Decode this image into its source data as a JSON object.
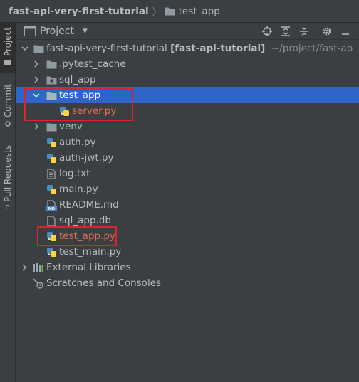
{
  "breadcrumb": {
    "root": "fast-api-very-first-tutorial",
    "current": "test_app"
  },
  "stripe": {
    "project": "Project",
    "commit": "Commit",
    "pull_requests": "Pull Requests"
  },
  "toolwindow": {
    "title": "Project",
    "dropdown_icon": "caret-down-icon",
    "actions": [
      "locate-icon",
      "expand-all-icon",
      "collapse-all-icon",
      "gear-icon",
      "minimize-icon"
    ]
  },
  "tree": {
    "root_name": "fast-api-very-first-tutorial",
    "root_module": "[fast-api-tutorial]",
    "root_path": "~/project/fast-ap",
    "items": [
      {
        "label": ".pytest_cache",
        "type": "folder",
        "expanded": false
      },
      {
        "label": "sql_app",
        "type": "package-folder",
        "expanded": false
      },
      {
        "label": "test_app",
        "type": "folder",
        "expanded": true,
        "selected": true
      },
      {
        "label": "server.py",
        "type": "python-file",
        "vcs": "untracked"
      },
      {
        "label": "venv",
        "type": "folder",
        "expanded": false
      },
      {
        "label": "auth.py",
        "type": "python-file"
      },
      {
        "label": "auth-jwt.py",
        "type": "python-file"
      },
      {
        "label": "log.txt",
        "type": "text-file"
      },
      {
        "label": "main.py",
        "type": "python-file"
      },
      {
        "label": "README.md",
        "type": "markdown-file"
      },
      {
        "label": "sql_app.db",
        "type": "db-file"
      },
      {
        "label": "test_app.py",
        "type": "python-file",
        "vcs": "untracked"
      },
      {
        "label": "test_main.py",
        "type": "python-file"
      }
    ],
    "external_libraries": "External Libraries",
    "scratches": "Scratches and Consoles"
  },
  "colors": {
    "background": "#3c3f41",
    "selection": "#2f65ca",
    "untracked_text": "#e06c5a",
    "highlight_box": "#d9252b"
  }
}
